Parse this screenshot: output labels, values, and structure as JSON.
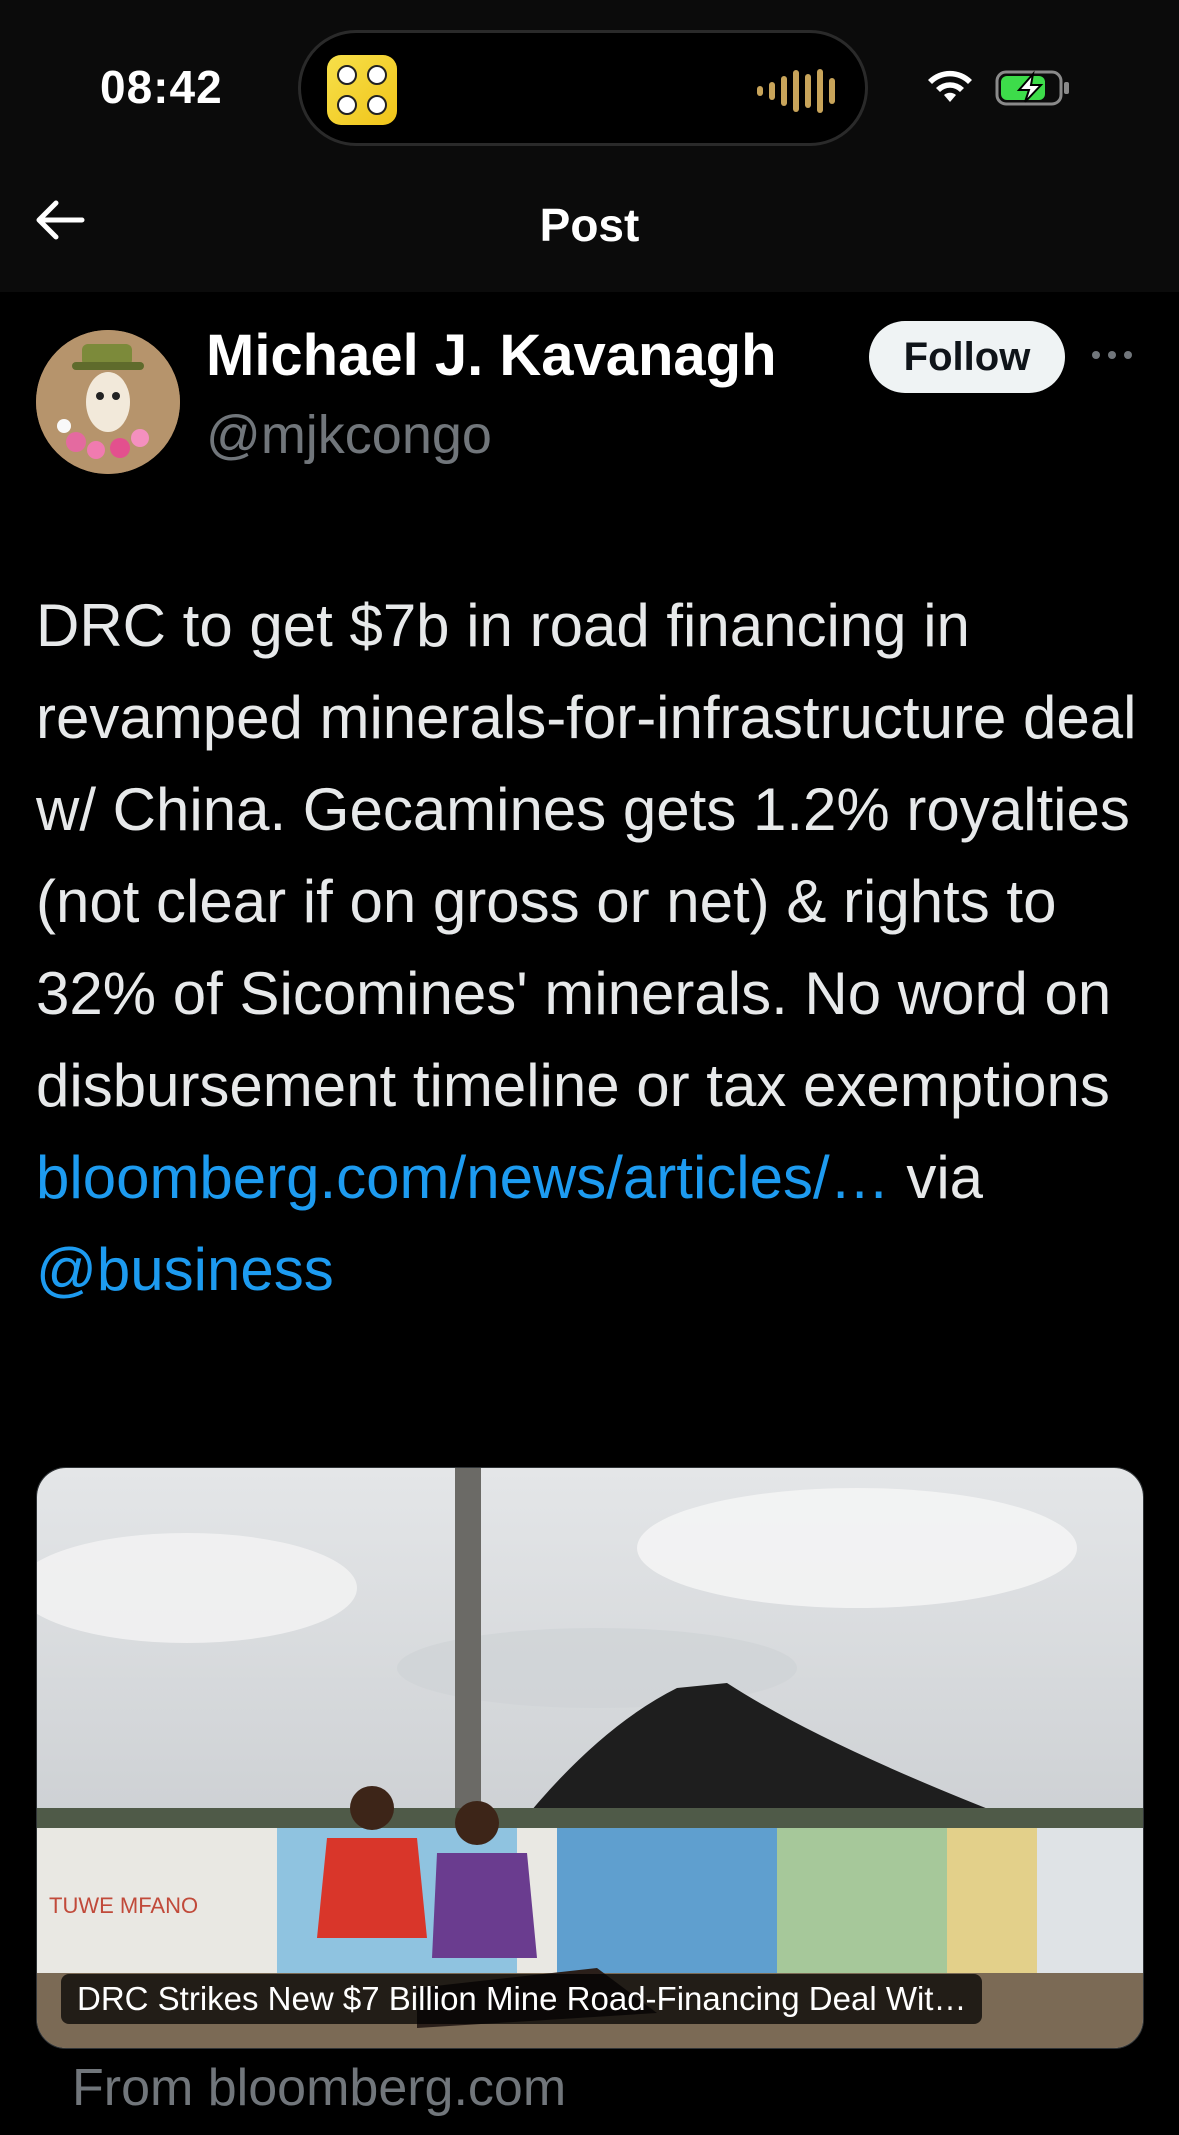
{
  "status_bar": {
    "time": "08:42"
  },
  "nav": {
    "title": "Post",
    "back_icon": "arrow-left-icon"
  },
  "author": {
    "name": "Michael J. Kavanagh",
    "handle": "@mjkcongo",
    "follow_label": "Follow",
    "more_icon": "more-horizontal-icon"
  },
  "tweet": {
    "text": "DRC to get $7b in road financing in revamped minerals-for-infrastructure deal w/ China. Gecamines gets 1.2% royalties (not clear if on gross or net) & rights to 32% of Sicomines' minerals. No word on disbursement timeline or tax exemptions",
    "link_text": "bloomberg.com/news/articles/…",
    "via_text": "via",
    "mention": "@business"
  },
  "card": {
    "title": "DRC Strikes New $7 Billion Mine Road-Financing Deal Wit…",
    "source": "From bloomberg.com",
    "mural_sign": "TUWE MFANO"
  },
  "colors": {
    "background": "#000000",
    "link": "#1d9bf0",
    "secondary_text": "#71767b",
    "follow_bg": "#eff3f4",
    "battery": "#3ddc4a"
  }
}
